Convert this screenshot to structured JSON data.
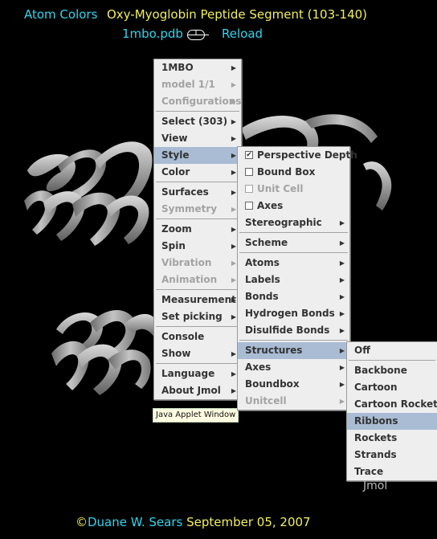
{
  "header": {
    "atom_colors": "Atom Colors",
    "title": "Oxy-Myoglobin Peptide Segment (103-140)",
    "pdb_file": "1mbo.pdb",
    "reload": "Reload"
  },
  "main_menu": {
    "items": [
      {
        "label": "1MBO",
        "submenu": true,
        "disabled": false
      },
      {
        "label": "model 1/1",
        "submenu": true,
        "disabled": true
      },
      {
        "label": "Configurations",
        "submenu": true,
        "disabled": true
      },
      {
        "label": "Select (303)",
        "submenu": true,
        "disabled": false
      },
      {
        "label": "View",
        "submenu": true,
        "disabled": false
      },
      {
        "label": "Style",
        "submenu": true,
        "disabled": false,
        "highlighted": true
      },
      {
        "label": "Color",
        "submenu": true,
        "disabled": false
      },
      {
        "label": "Surfaces",
        "submenu": true,
        "disabled": false
      },
      {
        "label": "Symmetry",
        "submenu": true,
        "disabled": true
      },
      {
        "label": "Zoom",
        "submenu": true,
        "disabled": false
      },
      {
        "label": "Spin",
        "submenu": true,
        "disabled": false
      },
      {
        "label": "Vibration",
        "submenu": true,
        "disabled": true
      },
      {
        "label": "Animation",
        "submenu": true,
        "disabled": true
      },
      {
        "label": "Measurement",
        "submenu": true,
        "disabled": false
      },
      {
        "label": "Set picking",
        "submenu": true,
        "disabled": false
      },
      {
        "label": "Console",
        "submenu": false,
        "disabled": false
      },
      {
        "label": "Show",
        "submenu": true,
        "disabled": false
      },
      {
        "label": "Language",
        "submenu": true,
        "disabled": false
      },
      {
        "label": "About Jmol",
        "submenu": true,
        "disabled": false
      }
    ]
  },
  "style_menu": {
    "items": [
      {
        "label": "Perspective Depth",
        "checked": true
      },
      {
        "label": "Bound Box",
        "checked": false
      },
      {
        "label": "Unit Cell",
        "checked": false,
        "disabled": true
      },
      {
        "label": "Axes",
        "checked": false
      },
      {
        "label": "Stereographic"
      },
      {
        "label": "Scheme"
      },
      {
        "label": "Atoms"
      },
      {
        "label": "Labels"
      },
      {
        "label": "Bonds"
      },
      {
        "label": "Hydrogen Bonds"
      },
      {
        "label": "Disulfide Bonds"
      },
      {
        "label": "Structures",
        "highlighted": true
      },
      {
        "label": "Axes"
      },
      {
        "label": "Boundbox"
      },
      {
        "label": "Unitcell",
        "disabled": true
      }
    ]
  },
  "structures_menu": {
    "items": [
      {
        "label": "Off"
      },
      {
        "label": "Backbone"
      },
      {
        "label": "Cartoon"
      },
      {
        "label": "Cartoon Rockets"
      },
      {
        "label": "Ribbons",
        "highlighted": true
      },
      {
        "label": "Rockets"
      },
      {
        "label": "Strands"
      },
      {
        "label": "Trace"
      }
    ]
  },
  "tooltip": "Java Applet Window",
  "watermark": "Jmol",
  "footer": {
    "copyright_symbol": "©",
    "author": "Duane W. Sears",
    "date": " September 05, 2007"
  },
  "colors": {
    "background": "#000000",
    "header_cyan": "#2fd6ef",
    "header_yellow": "#f2ef5a",
    "menu_bg": "#eeeeee",
    "menu_highlight": "#a9bcd4",
    "ribbon_gray": "#9a9a9a"
  }
}
